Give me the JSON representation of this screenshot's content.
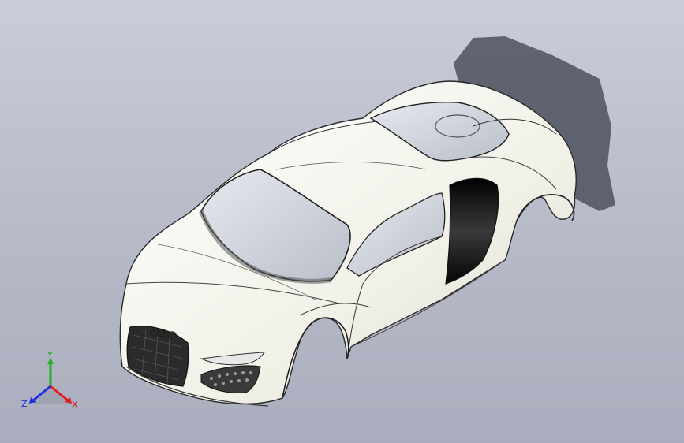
{
  "triad": {
    "x_label": "X",
    "y_label": "Y",
    "z_label": "Z",
    "x_color": "#e02020",
    "y_color": "#20b020",
    "z_color": "#2030e0"
  },
  "model": {
    "brand_icon": "four-rings-logo-icon",
    "body_color": "#f4f4ec",
    "edge_color": "#2a2a2a",
    "glass_color": "#c8ccd4",
    "shadow_color": "#4a4e5a"
  }
}
